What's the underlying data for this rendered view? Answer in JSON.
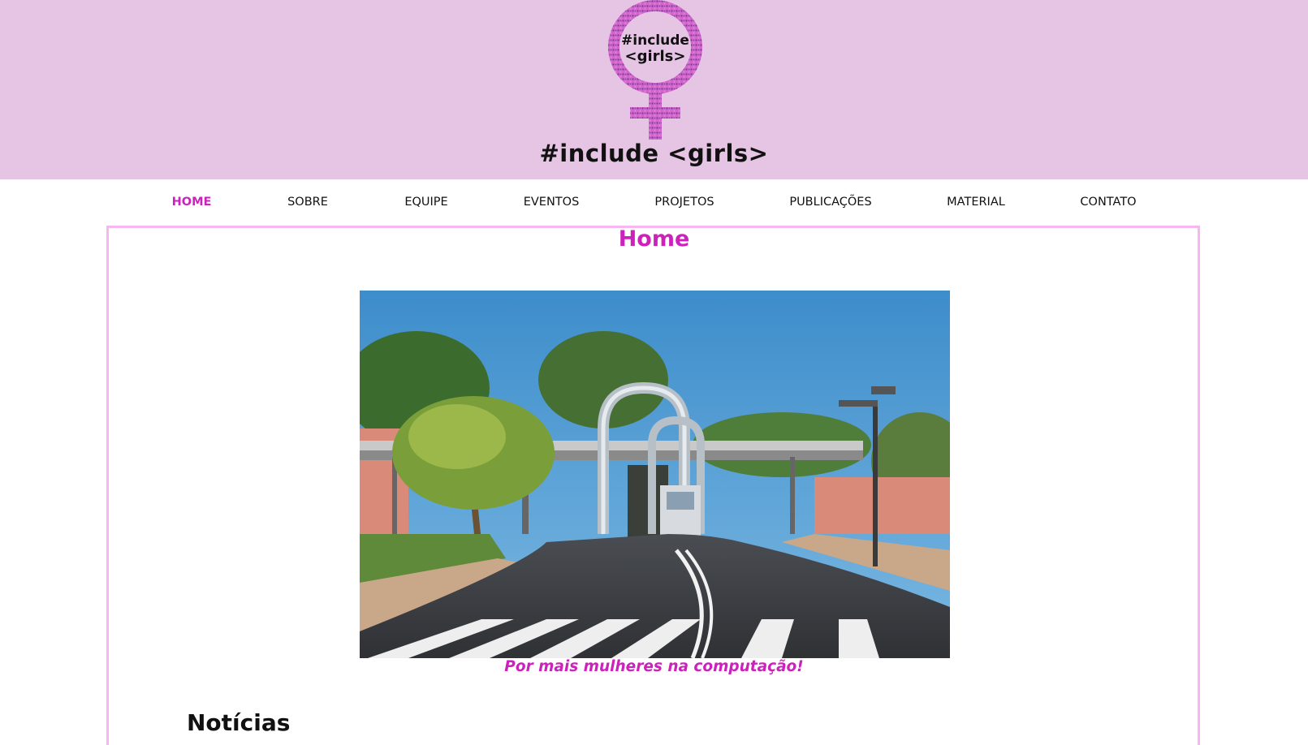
{
  "header": {
    "logo_text_top": "#include",
    "logo_text_bottom": "<girls>",
    "site_title": "#include <girls>",
    "background_color": "#e6c4e4",
    "logo_color": "#cc22bb"
  },
  "nav": {
    "items": [
      {
        "label": "HOME",
        "active": true
      },
      {
        "label": "SOBRE",
        "active": false
      },
      {
        "label": "EQUIPE",
        "active": false
      },
      {
        "label": "EVENTOS",
        "active": false
      },
      {
        "label": "PROJETOS",
        "active": false
      },
      {
        "label": "PUBLICAÇÕES",
        "active": false
      },
      {
        "label": "MATERIAL",
        "active": false
      },
      {
        "label": "CONTATO",
        "active": false
      }
    ],
    "active_color": "#cc22bb"
  },
  "main": {
    "heading": "Home",
    "hero_caption": "Por mais mulheres na computação!",
    "news_heading": "Notícias",
    "accent_color": "#cc22bb",
    "border_color": "#f6b6ef"
  }
}
